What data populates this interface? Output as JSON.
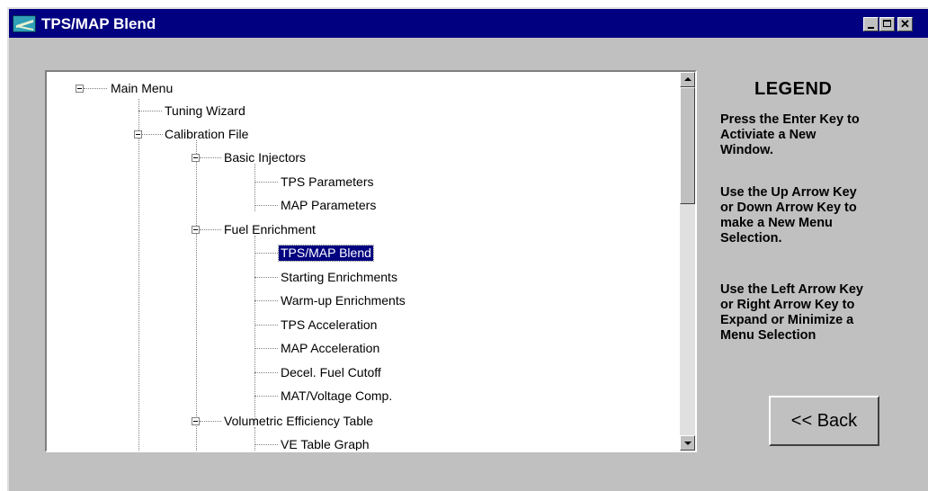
{
  "window": {
    "title": "TPS/MAP Blend"
  },
  "tree": {
    "root": "Main Menu",
    "tuning_wizard": "Tuning Wizard",
    "calibration_file": "Calibration File",
    "basic_injectors": "Basic Injectors",
    "tps_parameters": "TPS Parameters",
    "map_parameters": "MAP Parameters",
    "fuel_enrichment": "Fuel Enrichment",
    "tps_map_blend": "TPS/MAP Blend",
    "starting_enrichments": "Starting Enrichments",
    "warmup_enrichments": "Warm-up Enrichments",
    "tps_acceleration": "TPS Acceleration",
    "map_acceleration": "MAP Acceleration",
    "decel_fuel_cutoff": "Decel. Fuel Cutoff",
    "mat_voltage_comp": "MAT/Voltage Comp.",
    "volumetric_efficiency_table": "Volumetric Efficiency Table",
    "ve_table_graph": "VE Table Graph",
    "selected": "TPS/MAP Blend"
  },
  "legend": {
    "title": "LEGEND",
    "para1": [
      "Press the Enter Key to",
      "Activiate a New",
      "Window."
    ],
    "para2": [
      "Use the Up Arrow Key",
      "or Down Arrow Key to",
      "make a New Menu",
      "Selection."
    ],
    "para3": [
      "Use the Left Arrow Key",
      "or Right Arrow Key to",
      "Expand or Minimize a",
      "Menu Selection"
    ]
  },
  "buttons": {
    "back": "<< Back"
  }
}
